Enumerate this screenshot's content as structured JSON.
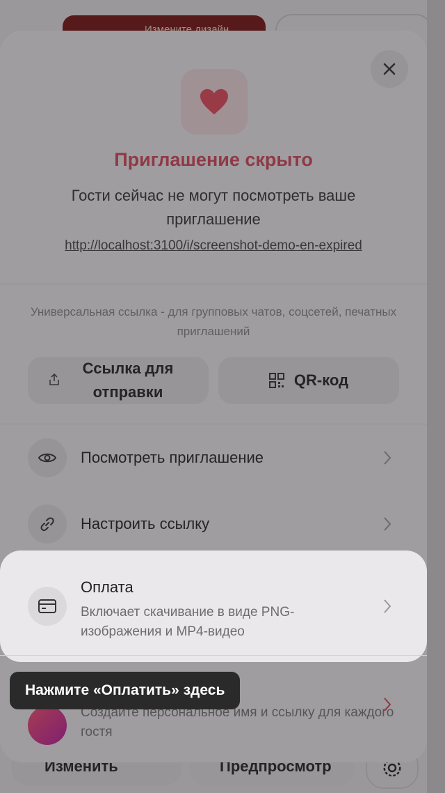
{
  "background": {
    "hero_text": "Измените дизайн",
    "change_button": "Изменить",
    "preview_button": "Предпросмотр"
  },
  "sheet": {
    "close_icon": "close-icon",
    "heart_icon": "heart-icon",
    "title": "Приглашение скрыто",
    "subtitle": "Гости сейчас не могут посмотреть ваше приглашение",
    "link": "http://localhost:3100/i/screenshot-demo-en-expired",
    "hint": "Универсальная ссылка - для групповых чатов, соцсетей, печатных приглашений",
    "share_link_label": "Ссылка для отправки",
    "qr_label": "QR-код",
    "rows": [
      {
        "label": "Посмотреть приглашение",
        "icon": "eye-icon"
      },
      {
        "label": "Настроить ссылку",
        "icon": "link-icon"
      }
    ],
    "payment": {
      "title": "Оплата",
      "description": "Включает скачивание в виде PNG-изображения и MP4-видео",
      "icon": "card-icon"
    },
    "personal": {
      "description": "Создайте персональное имя и ссылку для каждого гостя",
      "icon": "guests-icon"
    }
  },
  "tooltip": "Нажмите «Оплатить» здесь",
  "colors": {
    "accent": "#d9475a",
    "tooltip_bg": "#2a2a2a"
  }
}
